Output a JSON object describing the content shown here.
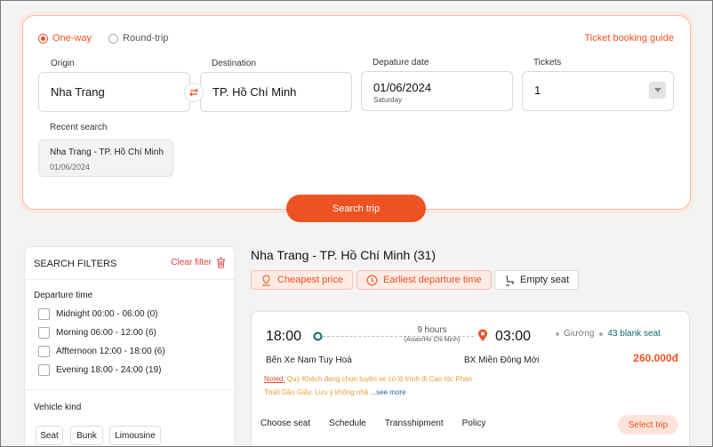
{
  "search": {
    "trip_types": [
      {
        "label": "One-way",
        "selected": true
      },
      {
        "label": "Round-trip",
        "selected": false
      }
    ],
    "guide_link": "Ticket booking guide",
    "origin": {
      "label": "Origin",
      "value": "Nha Trang"
    },
    "destination": {
      "label": "Destination",
      "value": "TP. Hồ Chí Minh"
    },
    "date": {
      "label": "Depature date",
      "value": "01/06/2024",
      "weekday": "Saturday"
    },
    "tickets": {
      "label": "Tickets",
      "value": "1"
    },
    "recent": {
      "label": "Recent search",
      "items": [
        {
          "route": "Nha Trang - TP. Hồ Chí Minh",
          "date": "01/06/2024"
        }
      ]
    },
    "button_label": "Search trip"
  },
  "filters": {
    "title": "SEARCH FILTERS",
    "clear_label": "Clear filter",
    "departure_title": "Departure time",
    "departure_options": [
      "Midnight 00:00 - 06:00 (0)",
      "Morning 06:00 - 12:00 (6)",
      "Affternoon 12:00 - 18:00 (6)",
      "Evening 18:00 - 24:00 (19)"
    ],
    "vehicle_title": "Vehicle kind",
    "vehicle_options": [
      "Seat",
      "Bunk",
      "Limousine"
    ]
  },
  "results": {
    "title": "Nha Trang - TP. Hồ Chí Minh (31)",
    "sort_options": [
      "Cheapest price",
      "Earliest departure time",
      "Empty seat"
    ],
    "trip": {
      "depart_time": "18:00",
      "arrive_time": "03:00",
      "duration": "9 hours",
      "timezone": "(Asian/Ho Chi Minh)",
      "from_station": "Bến Xe Nam Tuy Hoà",
      "to_station": "BX Miền Đông Mới",
      "seat_type": "Giường",
      "blank_seats": "43 blank seat",
      "price": "260.000đ",
      "note_label": "Noted:",
      "note_text": " Quý Khách đang chọn tuyến xe có lộ trình đi Cao tốc Phan Thiết Dầu Giây. Lưu ý không nhậ",
      "see_more": " ...see more",
      "tabs": [
        "Choose seat",
        "Schedule",
        "Transshipment",
        "Policy"
      ],
      "select_label": "Select trip"
    }
  },
  "colors": {
    "accent": "#ef5222",
    "teal": "#0b6b6b",
    "note": "#f29a36"
  }
}
